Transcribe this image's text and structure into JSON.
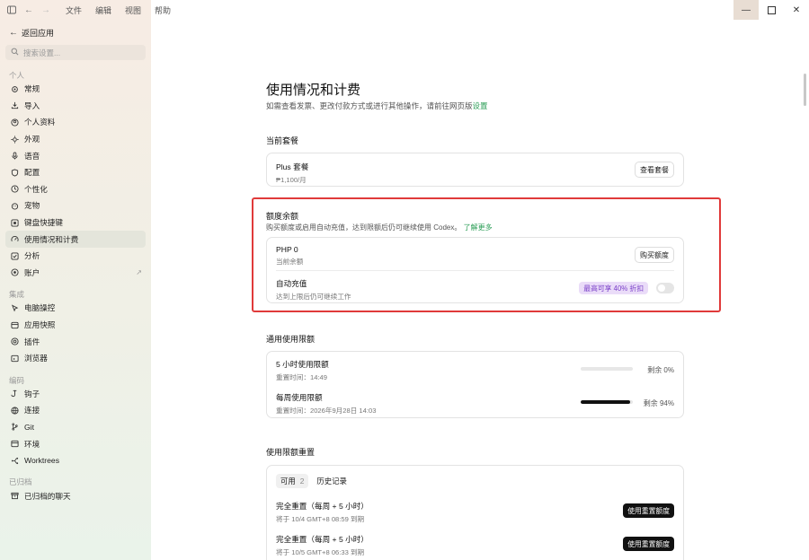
{
  "titlebar": {
    "menu": [
      "文件",
      "编辑",
      "视图",
      "帮助"
    ]
  },
  "sidebar": {
    "back_label": "返回应用",
    "search_placeholder": "搜索设置...",
    "section_personal": "个人",
    "personal_items": [
      {
        "label": "常规",
        "icon": "settings-icon"
      },
      {
        "label": "导入",
        "icon": "import-icon"
      },
      {
        "label": "个人资料",
        "icon": "profile-icon"
      },
      {
        "label": "外观",
        "icon": "appearance-icon"
      },
      {
        "label": "语音",
        "icon": "mic-icon"
      },
      {
        "label": "配置",
        "icon": "shield-icon"
      },
      {
        "label": "个性化",
        "icon": "personalize-icon"
      },
      {
        "label": "宠物",
        "icon": "pet-icon"
      },
      {
        "label": "键盘快捷键",
        "icon": "keyboard-icon"
      },
      {
        "label": "使用情况和计费",
        "icon": "gauge-icon"
      },
      {
        "label": "分析",
        "icon": "analytics-icon"
      },
      {
        "label": "账户",
        "icon": "account-icon"
      }
    ],
    "section_integrations": "集成",
    "integration_items": [
      {
        "label": "电脑操控",
        "icon": "cursor-icon"
      },
      {
        "label": "应用快照",
        "icon": "snapshot-icon"
      },
      {
        "label": "插件",
        "icon": "plugin-icon"
      },
      {
        "label": "浏览器",
        "icon": "browser-icon"
      }
    ],
    "section_coding": "编码",
    "coding_items": [
      {
        "label": "钩子",
        "icon": "hook-icon"
      },
      {
        "label": "连接",
        "icon": "globe-icon"
      },
      {
        "label": "Git",
        "icon": "git-icon"
      },
      {
        "label": "环境",
        "icon": "environment-icon"
      },
      {
        "label": "Worktrees",
        "icon": "worktree-icon"
      }
    ],
    "section_archived": "已归档",
    "archived_items": [
      {
        "label": "已归档的聊天",
        "icon": "archive-icon"
      }
    ]
  },
  "main": {
    "title": "使用情况和计费",
    "subtitle": "如需查看发票、更改付款方式或进行其他操作，请前往网页版",
    "subtitle_link": "设置",
    "current_plan": {
      "heading": "当前套餐",
      "name": "Plus 套餐",
      "price": "₱1,100/月",
      "button": "查看套餐"
    },
    "balance": {
      "heading": "额度余额",
      "description": "购买额度或启用自动充值，达到限额后仍可继续使用 Codex。",
      "learn_more": "了解更多",
      "amount": "PHP 0",
      "amount_label": "当前余额",
      "buy_button": "购买额度",
      "auto_title": "自动充值",
      "auto_sub": "达到上限后仍可继续工作",
      "promo": "最高可享 40% 折扣",
      "auto_enabled": false
    },
    "limits": {
      "heading": "通用使用限额",
      "items": [
        {
          "title": "5 小时使用限额",
          "reset": "重置时间：14:49",
          "remaining": "剩余 0%",
          "used_fraction": 0
        },
        {
          "title": "每周使用限额",
          "reset": "重置时间：2026年9月28日 14:03",
          "remaining": "剩余 94%",
          "used_fraction": 0.94
        }
      ]
    },
    "resets": {
      "heading": "使用限额重置",
      "tabs": [
        {
          "label": "可用",
          "count": "2"
        },
        {
          "label": "历史记录",
          "count": ""
        }
      ],
      "items": [
        {
          "title": "完全重置（每周 + 5 小时）",
          "expires": "将于 10/4 GMT+8 08:59 到期",
          "button": "使用重置额度"
        },
        {
          "title": "完全重置（每周 + 5 小时）",
          "expires": "将于 10/5 GMT+8 06:33 到期",
          "button": "使用重置额度"
        }
      ]
    }
  }
}
